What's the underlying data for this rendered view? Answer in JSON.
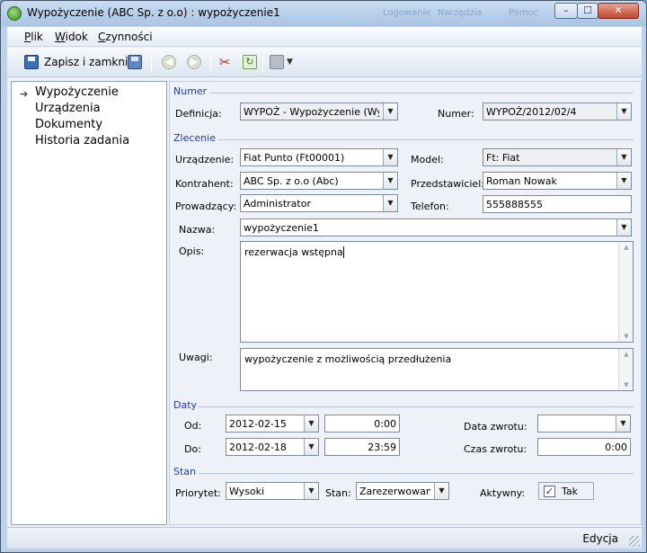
{
  "window": {
    "title": "Wypożyczenie (ABC Sp. z o.o) : wypożyczenie1",
    "background_hint": [
      "Logowanie",
      "Narzędzia",
      "Pomoc"
    ],
    "controls": {
      "minimize": "–",
      "maximize": "☐",
      "close": "✕"
    }
  },
  "menu": {
    "items": [
      {
        "label": "Plik",
        "key": "P"
      },
      {
        "label": "Widok",
        "key": "W"
      },
      {
        "label": "Czynności",
        "key": "C"
      }
    ]
  },
  "toolbar": {
    "save_close_label": "Zapisz i zamknij",
    "save_close_key": "Z",
    "icons": [
      "save-icon",
      "save-icon",
      "arrow-left-icon",
      "arrow-right-icon",
      "tools-icon",
      "refresh-icon",
      "print-icon"
    ]
  },
  "nav": {
    "items": [
      {
        "label": "Wypożyczenie",
        "selected": true
      },
      {
        "label": "Urządzenia"
      },
      {
        "label": "Dokumenty"
      },
      {
        "label": "Historia zadania"
      }
    ]
  },
  "form": {
    "numer": {
      "section": "Numer",
      "definicja_label": "Definicja:",
      "definicja_value": "WYPOŻ - Wypożyczenie (Wypoz",
      "numer_label": "Numer:",
      "numer_value": "WYPOŻ/2012/02/4"
    },
    "zlecenie": {
      "section": "Zlecenie",
      "urzadzenie_label": "Urządzenie:",
      "urzadzenie_value": "Fiat Punto (Ft00001)",
      "model_label": "Model:",
      "model_value": "Ft: Fiat",
      "kontrahent_label": "Kontrahent:",
      "kontrahent_value": "ABC Sp. z o.o (Abc)",
      "przedstawiciel_label": "Przedstawiciel:",
      "przedstawiciel_value": "Roman Nowak",
      "prowadzacy_label": "Prowadzący:",
      "prowadzacy_value": "Administrator",
      "telefon_label": "Telefon:",
      "telefon_value": "555888555",
      "nazwa_label": "Nazwa:",
      "nazwa_value": "wypożyczenie1",
      "opis_label": "Opis:",
      "opis_value": "rezerwacja wstępna",
      "uwagi_label": "Uwagi:",
      "uwagi_value": "wypożyczenie z możliwością przedłużenia"
    },
    "daty": {
      "section": "Daty",
      "od_label": "Od:",
      "od_date": "2012-02-15",
      "od_time": "0:00",
      "do_label": "Do:",
      "do_date": "2012-02-18",
      "do_time": "23:59",
      "data_zwrotu_label": "Data zwrotu:",
      "data_zwrotu_value": "",
      "czas_zwrotu_label": "Czas zwrotu:",
      "czas_zwrotu_value": "0:00"
    },
    "stan": {
      "section": "Stan",
      "priorytet_label": "Priorytet:",
      "priorytet_value": "Wysoki",
      "stan_label": "Stan:",
      "stan_value": "Zarezerwowane",
      "aktywny_label": "Aktywny:",
      "aktywny_checked": true,
      "aktywny_text": "Tak",
      "check_mark": "✓"
    }
  },
  "status": {
    "mode": "Edycja"
  }
}
